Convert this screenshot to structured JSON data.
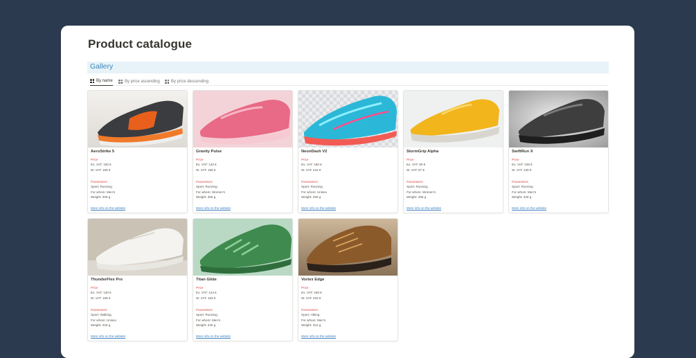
{
  "page": {
    "title": "Product catalogue"
  },
  "gallery": {
    "title": "Gallery"
  },
  "tabs": [
    {
      "label": "By name",
      "active": true
    },
    {
      "label": "By price ascending",
      "active": false
    },
    {
      "label": "By price descending",
      "active": false
    }
  ],
  "labels": {
    "price": "Price",
    "parameters": "Parameters",
    "link": "More info on the website"
  },
  "products": [
    {
      "name": "AeroStrike 5",
      "ex_vat": "Ex. VAT: 150 €",
      "w_vat": "W. VAT: 180 €",
      "sport": "Sport: Running",
      "for_whom": "For whom: Men's",
      "weight": "Weight: 300 g",
      "image": "dark-orange-running-shoe"
    },
    {
      "name": "Gravity Pulse",
      "ex_vat": "Ex. VAT: 140 €",
      "w_vat": "W. VAT: 168 €",
      "sport": "Sport: Running",
      "for_whom": "For whom: Women's",
      "weight": "Weight: 306 g",
      "image": "pink-running-shoe"
    },
    {
      "name": "NeonDash V2",
      "ex_vat": "Ex. VAT: 180 €",
      "w_vat": "W. VAT: 216 €",
      "sport": "Sport: Running",
      "for_whom": "For whom: Unisex",
      "weight": "Weight: 250 g",
      "image": "neon-blue-shoe"
    },
    {
      "name": "StormGrip Alpha",
      "ex_vat": "Ex. VAT: 80 €",
      "w_vat": "W. VAT: 97 €",
      "sport": "Sport: Running",
      "for_whom": "For whom: Women's",
      "weight": "Weight: 255 g",
      "image": "yellow-running-shoe"
    },
    {
      "name": "SwiftRun X",
      "ex_vat": "Ex. VAT: 108 €",
      "w_vat": "W. VAT: 130 €",
      "sport": "Sport: Running",
      "for_whom": "For whom: Men's",
      "weight": "Weight: 330 g",
      "image": "black-grey-shoe"
    },
    {
      "name": "ThunderFlex Pro",
      "ex_vat": "Ex. VAT: 130 €",
      "w_vat": "W. VAT: 165 €",
      "sport": "Sport: Walking",
      "for_whom": "For whom: Unisex",
      "weight": "Weight: 220 g",
      "image": "white-sneaker"
    },
    {
      "name": "Titan Glide",
      "ex_vat": "Ex. VAT: 124 €",
      "w_vat": "W. VAT: 153 €",
      "sport": "Sport: Running",
      "for_whom": "For whom: Men's",
      "weight": "Weight: 230 g",
      "image": "green-running-shoe"
    },
    {
      "name": "Vortex Edge",
      "ex_vat": "Ex. VAT: 168 €",
      "w_vat": "W. VAT: 203 €",
      "sport": "Sport: Hiking",
      "for_whom": "For whom: Men's",
      "weight": "Weight: 310 g",
      "image": "brown-hiking-boot"
    }
  ],
  "colors": {
    "background": "#2b3a4e",
    "gallery_header_bg": "#e7f3f8",
    "gallery_title": "#3a86b8",
    "section_label": "#d44c47",
    "link": "#3b7fbf"
  }
}
